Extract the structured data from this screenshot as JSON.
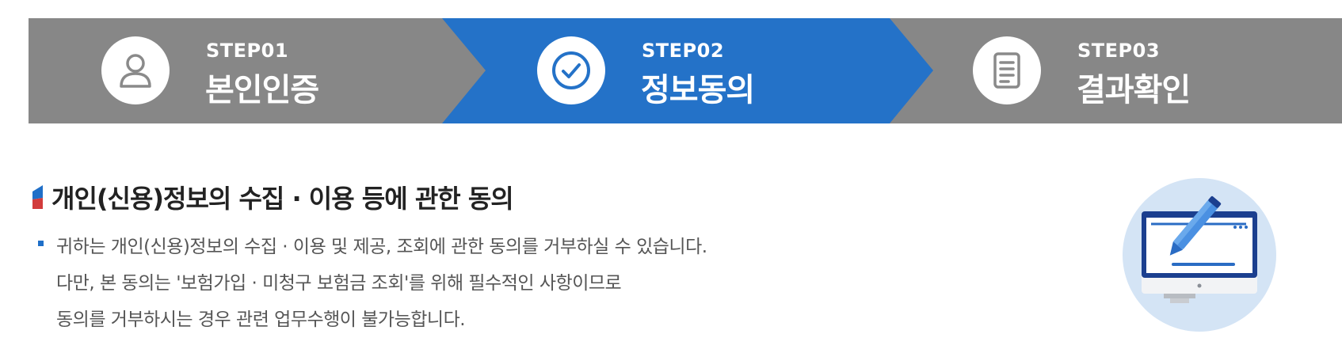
{
  "steps": [
    {
      "number": "STEP01",
      "label": "본인인증",
      "icon": "user-icon",
      "active": false
    },
    {
      "number": "STEP02",
      "label": "정보동의",
      "icon": "check-circle-icon",
      "active": true
    },
    {
      "number": "STEP03",
      "label": "결과확인",
      "icon": "document-icon",
      "active": false
    }
  ],
  "colors": {
    "inactive_step": "#878787",
    "active_step": "#2472c8",
    "title_mark_blue": "#1f6fc8",
    "title_mark_red": "#d23c3c"
  },
  "consent": {
    "title": "개인(신용)정보의 수집 · 이용 등에 관한 동의",
    "lines": [
      "귀하는 개인(신용)정보의 수집 · 이용 및 제공, 조회에 관한 동의를 거부하실 수 있습니다.",
      "다만, 본 동의는 '보험가입 · 미청구 보험금 조회'를 위해 필수적인 사항이므로",
      "동의를 거부하시는 경우 관련 업무수행이 불가능합니다."
    ],
    "illustration_icon": "monitor-pen-icon"
  }
}
